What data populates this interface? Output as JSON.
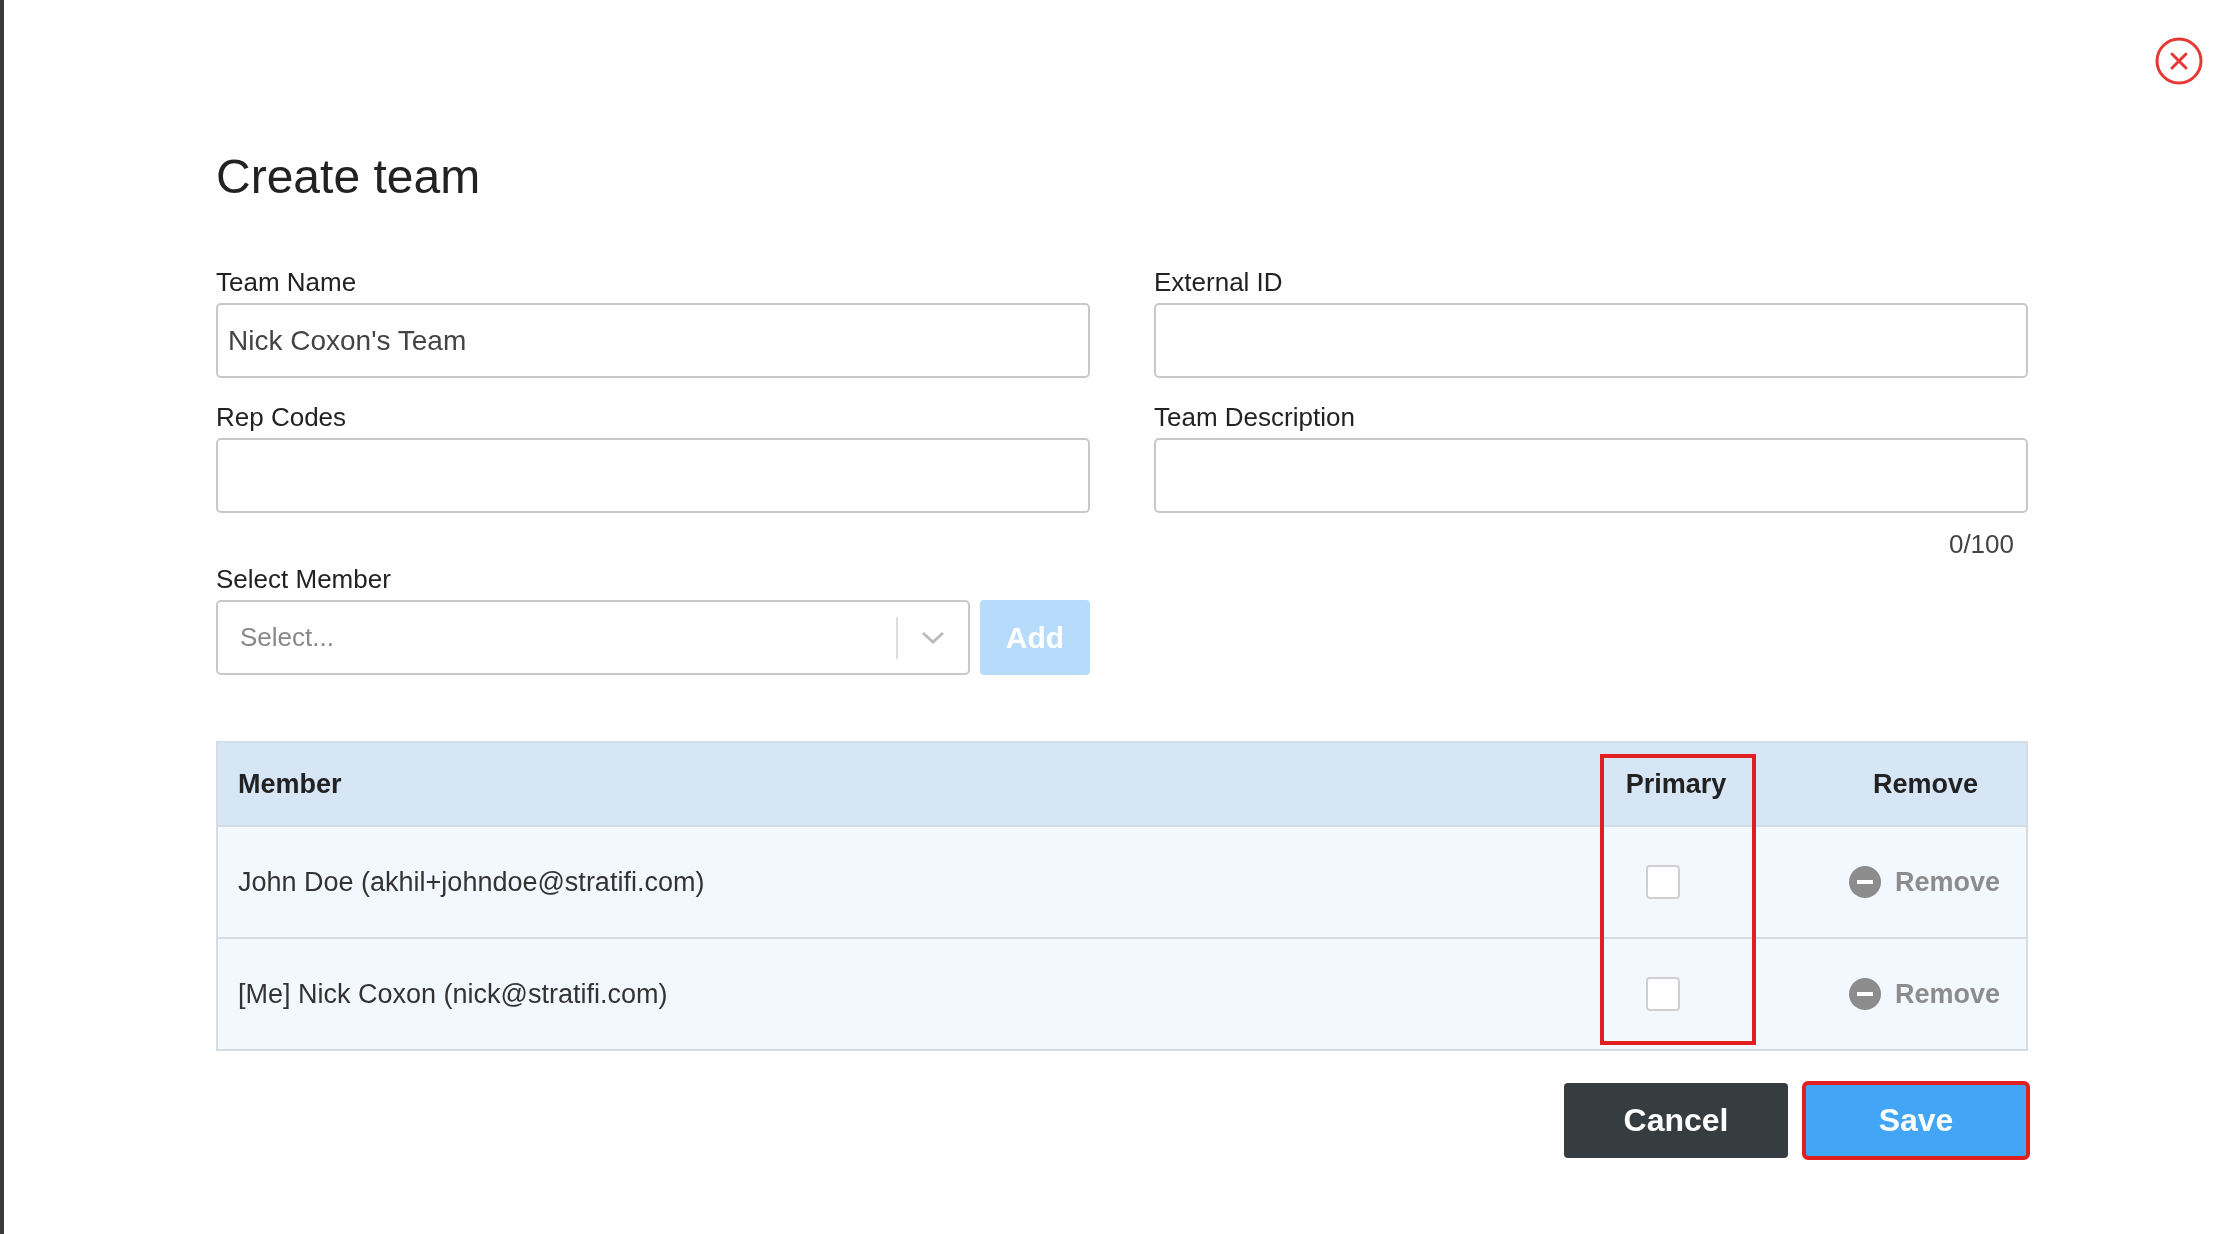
{
  "title": "Create team",
  "fields": [
    {
      "label": "Team Name",
      "value": "Nick Coxon's Team"
    },
    {
      "label": "External ID"
    },
    {
      "label": "Rep Codes"
    },
    {
      "label": "Team Description",
      "counter": "0/100"
    }
  ],
  "select_member": {
    "label": "Select Member",
    "placeholder": "Select...",
    "add_button": {
      "label": "Add",
      "disabled": true
    }
  },
  "table": {
    "columns": [
      "Member",
      "Primary",
      "Remove"
    ],
    "rows": [
      {
        "member": "John Doe (akhil+johndoe@stratifi.com)",
        "primary": {
          "checked": false
        },
        "remove": "Remove"
      },
      {
        "member": "[Me] Nick Coxon (nick@stratifi.com)",
        "primary": {
          "checked": false
        },
        "remove": "Remove"
      }
    ]
  },
  "buttons": [
    {
      "kind": "cancel",
      "label": "Cancel"
    },
    {
      "kind": "save",
      "label": "Save"
    }
  ]
}
